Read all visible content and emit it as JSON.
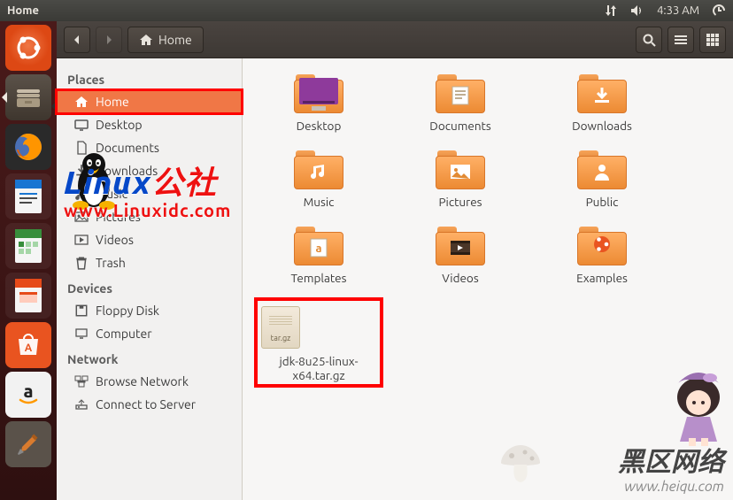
{
  "panel": {
    "title": "Home",
    "time": "4:33 AM"
  },
  "toolbar": {
    "path_label": "Home"
  },
  "launcher_tooltip": "Files",
  "sidebar": {
    "sections": {
      "places": "Places",
      "devices": "Devices",
      "network": "Network"
    },
    "places": [
      {
        "label": "Home",
        "icon": "home",
        "selected": true
      },
      {
        "label": "Desktop",
        "icon": "desktop"
      },
      {
        "label": "Documents",
        "icon": "document"
      },
      {
        "label": "Downloads",
        "icon": "download"
      },
      {
        "label": "Music",
        "icon": "music"
      },
      {
        "label": "Pictures",
        "icon": "picture"
      },
      {
        "label": "Videos",
        "icon": "video"
      },
      {
        "label": "Trash",
        "icon": "trash"
      }
    ],
    "devices": [
      {
        "label": "Floppy Disk",
        "icon": "disk"
      },
      {
        "label": "Computer",
        "icon": "computer"
      }
    ],
    "network": [
      {
        "label": "Browse Network",
        "icon": "network"
      },
      {
        "label": "Connect to Server",
        "icon": "server"
      }
    ]
  },
  "folders": [
    {
      "label": "Desktop",
      "kind": "desktop"
    },
    {
      "label": "Documents",
      "kind": "document"
    },
    {
      "label": "Downloads",
      "kind": "download"
    },
    {
      "label": "Music",
      "kind": "music"
    },
    {
      "label": "Pictures",
      "kind": "picture"
    },
    {
      "label": "Public",
      "kind": "public"
    },
    {
      "label": "Templates",
      "kind": "template"
    },
    {
      "label": "Videos",
      "kind": "video"
    },
    {
      "label": "Examples",
      "kind": "examples"
    }
  ],
  "file": {
    "label": "jdk-8u25-linux-x64.tar.gz",
    "badge": "tar.gz"
  },
  "watermark1": {
    "line1_a": "Linux",
    "line1_b": "公社",
    "line2": "www.Linuxidc.com"
  },
  "watermark2": {
    "line1": "黑区网络",
    "line2": "www.heiqu.com"
  }
}
